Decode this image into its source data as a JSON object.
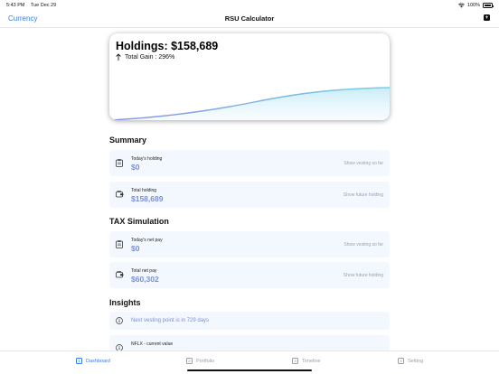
{
  "status_bar": {
    "time": "5:43 PM",
    "date": "Tue Dec 29",
    "battery": "100%"
  },
  "nav": {
    "left_label": "Currency",
    "title": "RSU Calculator",
    "right_icon": "plus-square-icon"
  },
  "hero": {
    "title": "Holdings: $158,689",
    "gain_label": "Total Gain : 296%"
  },
  "summary": {
    "header": "Summary",
    "cards": [
      {
        "label": "Today's holding",
        "value": "$0",
        "action": "Show vesting so far"
      },
      {
        "label": "Total holding",
        "value": "$158,689",
        "action": "Show future holding"
      }
    ]
  },
  "tax": {
    "header": "TAX Simulation",
    "cards": [
      {
        "label": "Today's net pay",
        "value": "$0",
        "action": "Show vesting so far"
      },
      {
        "label": "Total net pay",
        "value": "$60,302",
        "action": "Show future holding"
      }
    ]
  },
  "insights": {
    "header": "Insights",
    "items": [
      {
        "text": "Next vesting point is in 729 days"
      },
      {
        "label": "NFLX - current value"
      }
    ]
  },
  "tabs": [
    {
      "number": "1",
      "label": "Dashboard",
      "active": true
    },
    {
      "number": "2",
      "label": "Portfolio",
      "active": false
    },
    {
      "number": "3",
      "label": "Timeline",
      "active": false
    },
    {
      "number": "4",
      "label": "Setting",
      "active": false
    }
  ],
  "colors": {
    "accent": "#2f7cf6",
    "value": "#7a8fdc",
    "card_bg": "#f3f7fe",
    "chart_line_start": "#8a8fe0",
    "chart_line_end": "#6fd3ea"
  }
}
